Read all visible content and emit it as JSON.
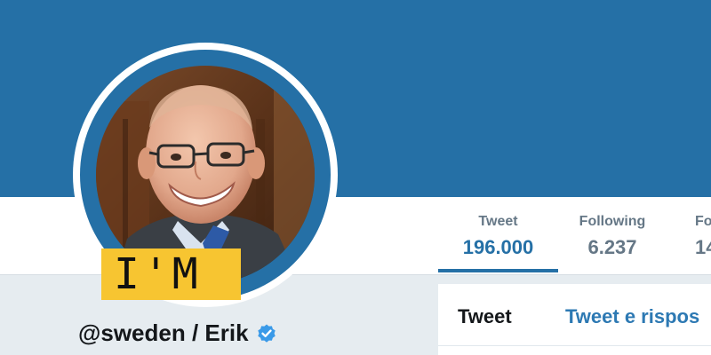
{
  "profile": {
    "handle": "@sweden / Erik",
    "badge_text": "I'M",
    "verified": true
  },
  "stats": [
    {
      "label": "Tweet",
      "value": "196.000",
      "active": true
    },
    {
      "label": "Following",
      "value": "6.237",
      "active": false
    },
    {
      "label": "Fo",
      "value": "14",
      "active": false
    }
  ],
  "tabs": [
    {
      "label": "Tweet",
      "active": true
    },
    {
      "label": "Tweet e rispos",
      "active": false
    }
  ],
  "colors": {
    "header": "#2570a6",
    "accent": "#2570a6",
    "badge": "#f7c531",
    "background": "#e6ecf0"
  },
  "icons": {
    "verified": "verified-badge-icon"
  }
}
